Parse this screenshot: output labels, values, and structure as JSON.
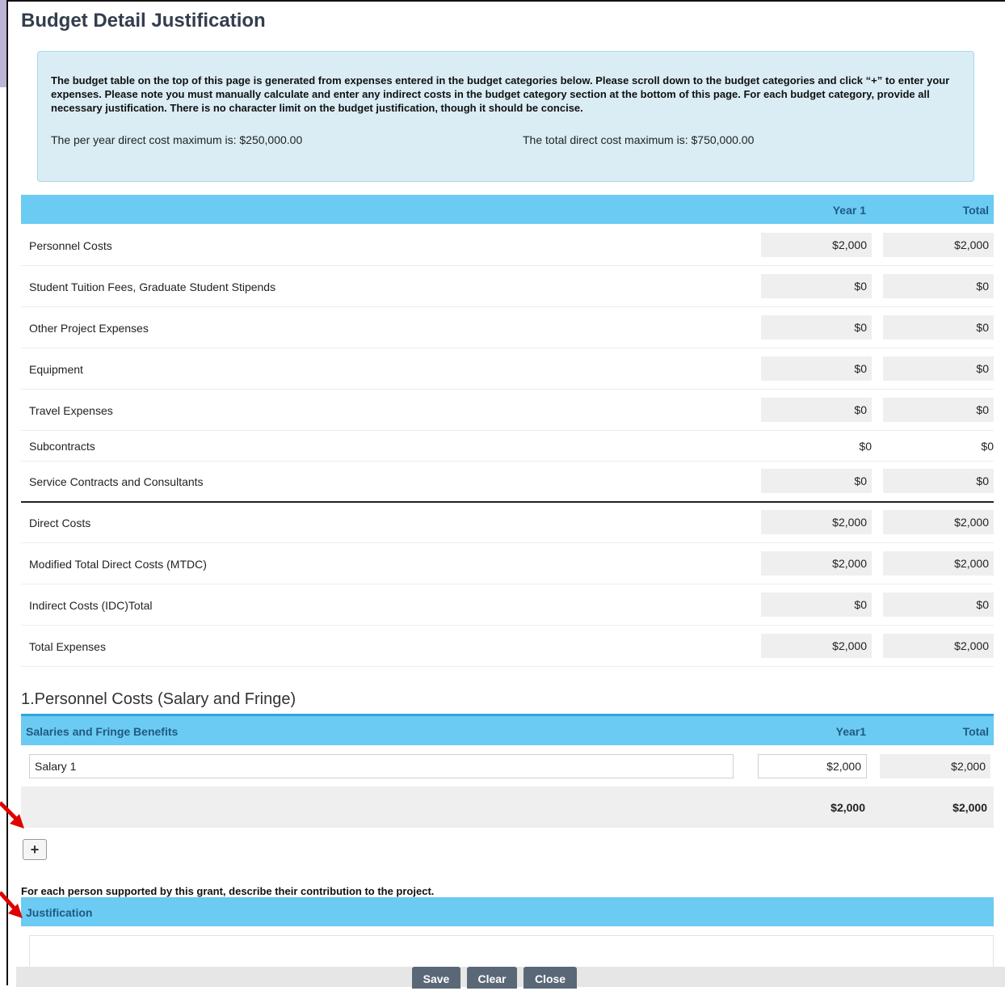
{
  "page": {
    "title": "Budget Detail Justification"
  },
  "info_box": {
    "text": "The budget table on the top of this page is generated from expenses entered in the budget categories below. Please scroll down to the budget categories and click “+” to enter your expenses. Please note you must manually calculate and enter any indirect costs in the budget category section at the bottom of this page. For each budget category, provide all necessary justification. There is no character limit on the budget justification, though it should be concise.",
    "per_year_max": "The per year direct cost maximum is: $250,000.00",
    "total_max": "The total direct cost maximum is: $750,000.00"
  },
  "summary_table": {
    "headers": {
      "year1": "Year 1",
      "total": "Total"
    },
    "rows": [
      {
        "label": "Personnel Costs",
        "year1": "$2,000",
        "total": "$2,000"
      },
      {
        "label": "Student Tuition Fees, Graduate Student Stipends",
        "year1": "$0",
        "total": "$0"
      },
      {
        "label": "Other Project Expenses",
        "year1": "$0",
        "total": "$0"
      },
      {
        "label": "Equipment",
        "year1": "$0",
        "total": "$0"
      },
      {
        "label": "Travel Expenses",
        "year1": "$0",
        "total": "$0"
      },
      {
        "label": "Subcontracts",
        "year1": "$0",
        "total": "$0"
      },
      {
        "label": "Service Contracts and Consultants",
        "year1": "$0",
        "total": "$0"
      },
      {
        "label": "Direct Costs",
        "year1": "$2,000",
        "total": "$2,000"
      },
      {
        "label": "Modified Total Direct Costs (MTDC)",
        "year1": "$2,000",
        "total": "$2,000"
      },
      {
        "label": "Indirect Costs (IDC)Total",
        "year1": "$0",
        "total": "$0"
      },
      {
        "label": "Total Expenses",
        "year1": "$2,000",
        "total": "$2,000"
      }
    ]
  },
  "personnel_section": {
    "title": "1.Personnel Costs (Salary and Fringe)",
    "headers": {
      "name": "Salaries and Fringe Benefits",
      "year1": "Year1",
      "total": "Total"
    },
    "rows": [
      {
        "name": "Salary 1",
        "year1": "$2,000",
        "total": "$2,000"
      }
    ],
    "totals": {
      "year1": "$2,000",
      "total": "$2,000"
    },
    "add_label": "+",
    "instruction": "For each person supported by this grant, describe their contribution to the project.",
    "justification_header": "Justification"
  },
  "buttons": {
    "save": "Save",
    "clear": "Clear",
    "close": "Close"
  },
  "colors": {
    "header_blue": "#6ccbf2",
    "info_bg": "#daedf5",
    "button_gray": "#5a6776",
    "arrow_red": "#e00000"
  }
}
